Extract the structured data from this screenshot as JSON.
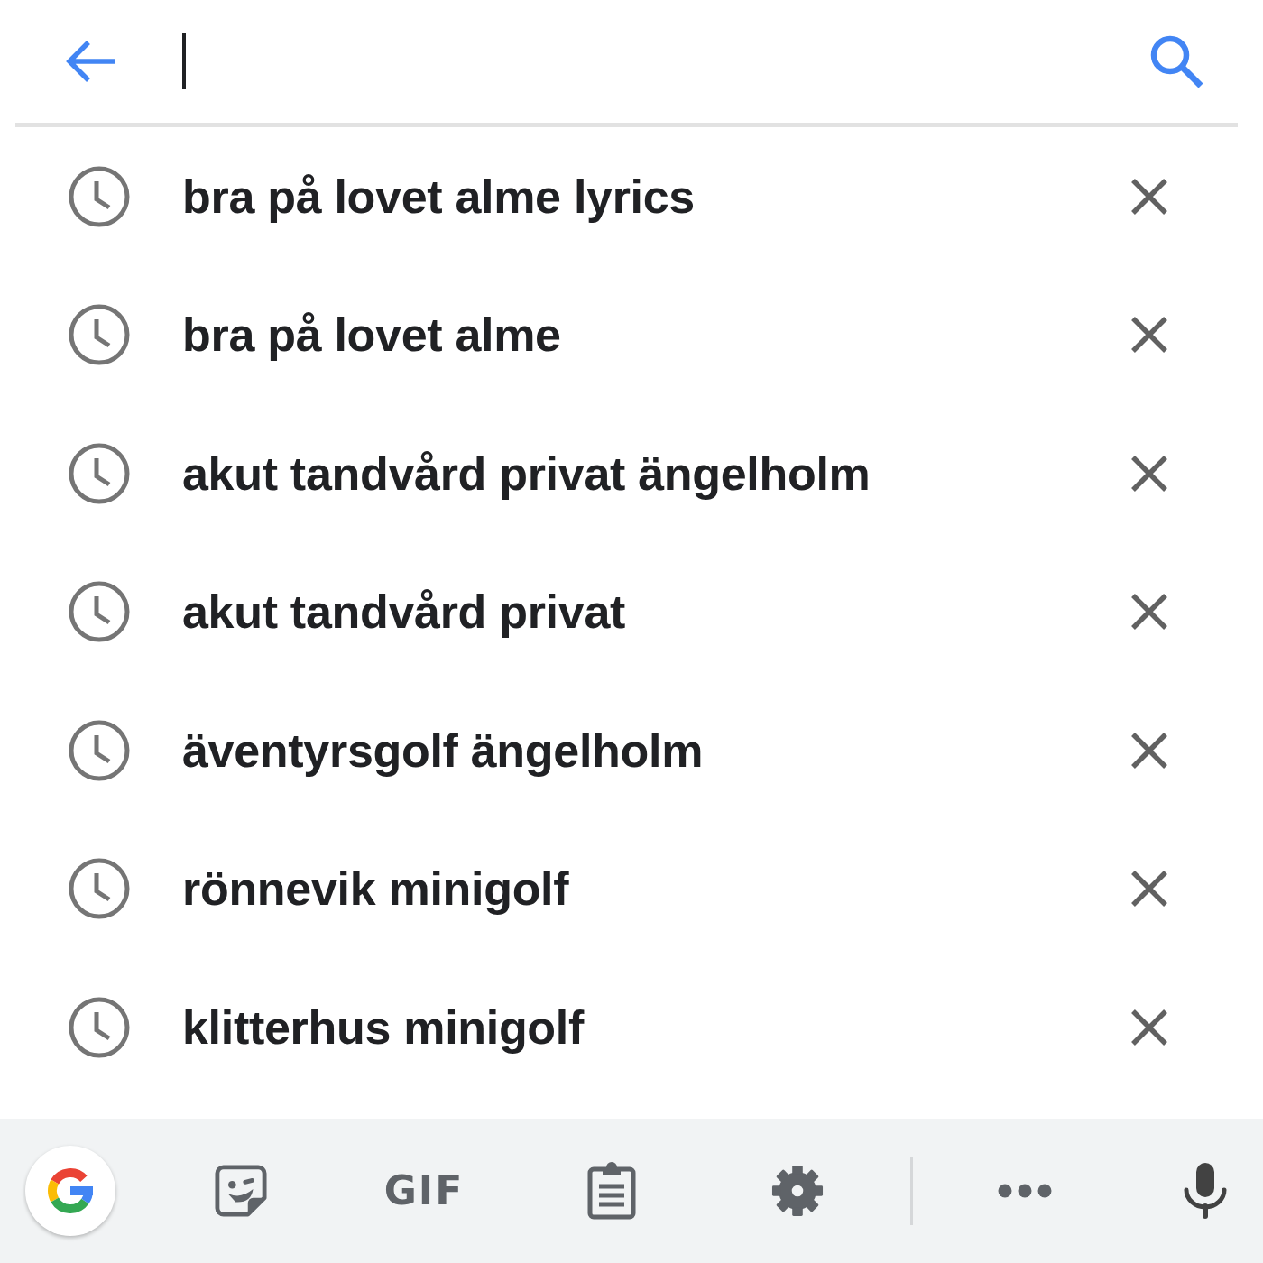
{
  "search_bar": {
    "focused": true
  },
  "suggestions": [
    {
      "text": "bra på lovet alme lyrics"
    },
    {
      "text": "bra på lovet alme"
    },
    {
      "text": "akut tandvård privat ängelholm"
    },
    {
      "text": "akut tandvård privat"
    },
    {
      "text": "äventyrsgolf ängelholm"
    },
    {
      "text": "rönnevik minigolf"
    },
    {
      "text": "klitterhus minigolf"
    }
  ],
  "keyboard_toolbar": {
    "gif_label": "GIF"
  }
}
